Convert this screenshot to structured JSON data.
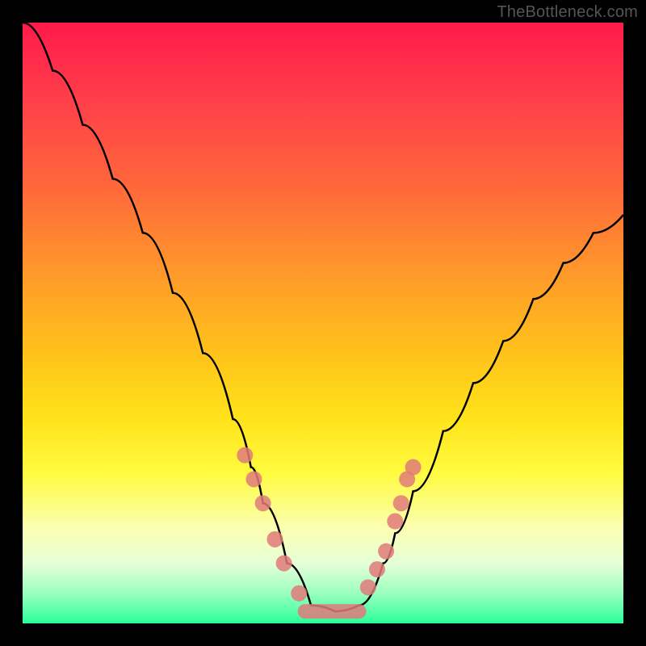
{
  "watermark": "TheBottleneck.com",
  "chart_data": {
    "type": "line",
    "title": "",
    "xlabel": "",
    "ylabel": "",
    "xlim": [
      0,
      100
    ],
    "ylim": [
      0,
      100
    ],
    "grid": false,
    "legend": false,
    "series": [
      {
        "name": "bottleneck-curve",
        "x": [
          0,
          5,
          10,
          15,
          20,
          25,
          30,
          35,
          38,
          40,
          44,
          48,
          52,
          56,
          60,
          62,
          65,
          70,
          75,
          80,
          85,
          90,
          95,
          100
        ],
        "y": [
          100,
          92,
          83,
          74,
          65,
          55,
          45,
          34,
          26,
          20,
          10,
          3,
          2,
          3,
          10,
          15,
          22,
          32,
          40,
          47,
          54,
          60,
          65,
          68
        ]
      }
    ],
    "markers_left": [
      {
        "x": 37,
        "y": 28
      },
      {
        "x": 38.5,
        "y": 24
      },
      {
        "x": 40,
        "y": 20
      },
      {
        "x": 42,
        "y": 14
      },
      {
        "x": 43.5,
        "y": 10
      },
      {
        "x": 46,
        "y": 5
      }
    ],
    "markers_right": [
      {
        "x": 57.5,
        "y": 6
      },
      {
        "x": 59,
        "y": 9
      },
      {
        "x": 60.5,
        "y": 12
      },
      {
        "x": 62,
        "y": 17
      },
      {
        "x": 63,
        "y": 20
      },
      {
        "x": 64,
        "y": 24
      },
      {
        "x": 65,
        "y": 26
      }
    ],
    "flat_segment": {
      "x0": 47,
      "x1": 56,
      "y": 2
    },
    "background_gradient": [
      "#ff1a4a",
      "#ff9a2a",
      "#ffe31a",
      "#fbffb0",
      "#2aff9a"
    ]
  }
}
